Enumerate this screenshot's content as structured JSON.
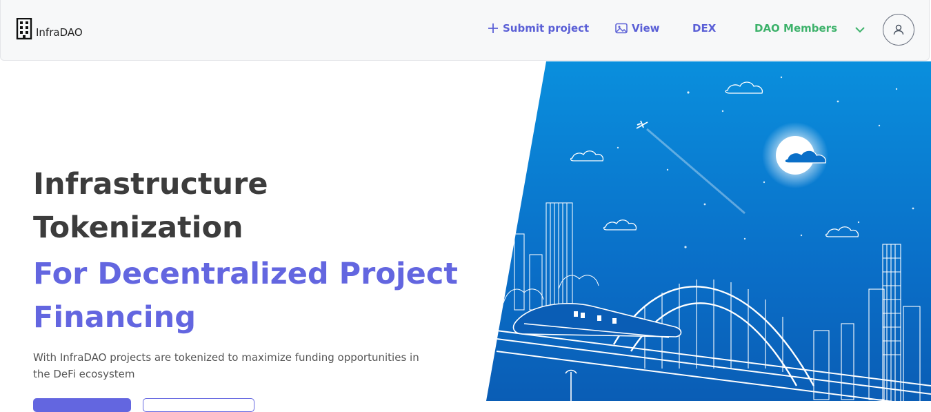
{
  "header": {
    "logo_text": "InfraDAO",
    "nav": {
      "submit": "Submit project",
      "view": "View",
      "dex": "DEX",
      "dao": "DAO Members"
    }
  },
  "hero": {
    "title_line1": "Infrastructure",
    "title_line2": "Tokenization",
    "subtitle_line1": "For Decentralized Project",
    "subtitle_line2": "Financing",
    "description": "With InfraDAO projects are tokenized to maximize funding opportunities in the DeFi ecosystem"
  },
  "colors": {
    "accent": "#6366e0",
    "dao_green": "#3db26b",
    "sky_top": "#0a5fb8",
    "sky_bottom": "#0b8fe0"
  }
}
